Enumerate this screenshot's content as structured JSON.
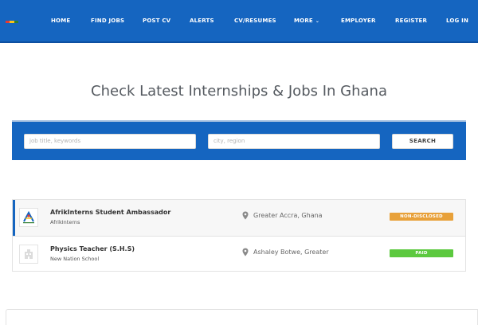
{
  "header": {
    "logo_colors": [
      "#e53935",
      "#f9c21a",
      "#2e7d32"
    ],
    "nav": [
      {
        "label": "HOME"
      },
      {
        "label": "FIND JOBS"
      },
      {
        "label": "POST CV"
      },
      {
        "label": "ALERTS"
      },
      {
        "label": "CV/RESUMES"
      },
      {
        "label": "MORE",
        "has_dropdown": true
      },
      {
        "label": "EMPLOYER"
      },
      {
        "label": "REGISTER"
      },
      {
        "label": "LOG IN"
      }
    ]
  },
  "hero": {
    "title": "Check Latest Internships & Jobs In Ghana"
  },
  "search": {
    "keywords_placeholder": "job title, keywords",
    "location_placeholder": "city, region",
    "button_label": "SEARCH"
  },
  "jobs": [
    {
      "title": "AfrikInterns Student Ambassador",
      "company": "AfrikInterns",
      "location": "Greater Accra, Ghana",
      "salary_badge": "NON-DISCLOSED",
      "badge_color": "#e8a13a",
      "featured": true,
      "logo": "afrikinterns-logo"
    },
    {
      "title": "Physics Teacher (S.H.S)",
      "company": "New Nation School",
      "location": "Ashaley Botwe, Greater",
      "salary_badge": "PAID",
      "badge_color": "#5cc93f",
      "featured": false,
      "logo": "building-placeholder-icon"
    }
  ],
  "colors": {
    "primary": "#1565c0",
    "nav_text": "#ffffff"
  }
}
